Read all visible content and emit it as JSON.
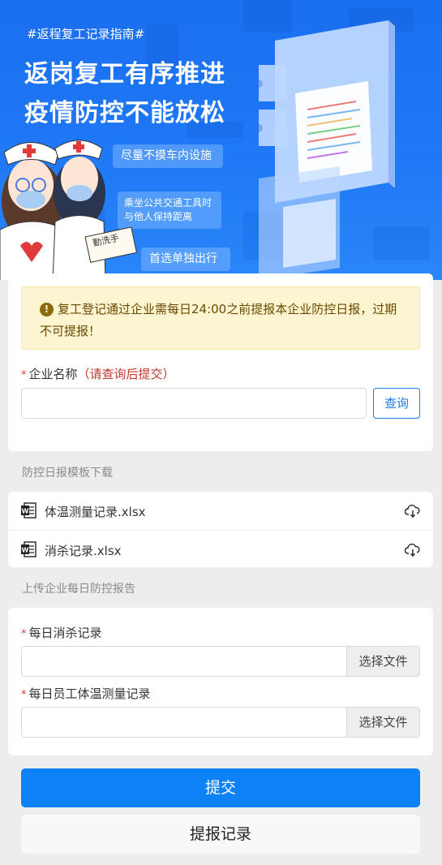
{
  "banner": {
    "hashtag": "#返程复工记录指南#",
    "headline_line1": "返岗复工有序推进",
    "headline_line2": "疫情防控不能放松",
    "tip1": "尽量不摸车内设施",
    "tip2": "乘坐公共交通工具时与他人保持距离",
    "tip3": "首选单独出行",
    "sign_text": "勤洗手",
    "colors": {
      "background": "#1f78f5",
      "text": "#ffffff"
    }
  },
  "notice": {
    "icon": "exclamation-circle-icon",
    "text": "复工登记通过企业需每日24:00之前提报本企业防控日报，过期不可提报！"
  },
  "company_field": {
    "required_mark": "*",
    "label": "企业名称",
    "hint": "（请查询后提交）",
    "value": "",
    "query_button": "查询"
  },
  "templates": {
    "section_title": "防控日报模板下载",
    "files": [
      {
        "name": "体温测量记录.xlsx",
        "icon": "word-document-icon",
        "action_icon": "cloud-download-icon"
      },
      {
        "name": "消杀记录.xlsx",
        "icon": "word-document-icon",
        "action_icon": "cloud-download-icon"
      }
    ]
  },
  "upload": {
    "section_title": "上传企业每日防控报告",
    "fields": [
      {
        "required_mark": "*",
        "label": "每日消杀记录",
        "value": "",
        "button": "选择文件"
      },
      {
        "required_mark": "*",
        "label": "每日员工体温测量记录",
        "value": "",
        "button": "选择文件"
      }
    ]
  },
  "actions": {
    "submit": "提交",
    "records": "提报记录",
    "colors": {
      "primary": "#0d82f7",
      "secondary": "#f7f8f9"
    }
  }
}
